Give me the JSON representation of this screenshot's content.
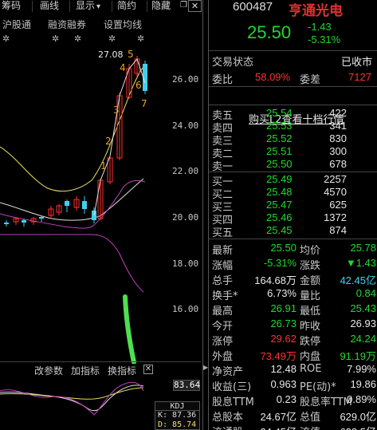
{
  "toolbar": {
    "items": [
      "筹码",
      "画线",
      "显示",
      "简约",
      "隐藏"
    ],
    "display_arrow": "▾",
    "restore_icon": "❐",
    "close_icon": "✕"
  },
  "subbar": {
    "items": [
      "沪股通",
      "融资融券",
      "设置均线"
    ],
    "gear": "✲"
  },
  "chart": {
    "price_ticks": [
      "26.00",
      "24.00",
      "22.00",
      "20.00",
      "18.00",
      "16.00"
    ],
    "high_label": "27.08",
    "wave_labels": [
      "1",
      "2",
      "3",
      "4",
      "5",
      "6",
      "7"
    ]
  },
  "indicator": {
    "tabs": [
      "改参数",
      "加指标",
      "换指标"
    ],
    "close": "✕",
    "last_value": "83.64",
    "kdj_title": "KDJ",
    "k_label": "K: 87.36",
    "d_label": "D: 85.74"
  },
  "quote": {
    "code": "600487",
    "name": "亨通光电",
    "price": "25.50",
    "change": "-1.43",
    "change_pct": "-5.31%",
    "trade_status_label": "交易状态",
    "trade_status": "已收市",
    "weibi_label": "委比",
    "weibi": "58.09%",
    "weicha_label": "委差",
    "weicha": "7127",
    "l2_link": "购买L2查看十档行情",
    "asks": [
      {
        "label": "卖五",
        "price": "25.54",
        "vol": "422"
      },
      {
        "label": "卖四",
        "price": "25.53",
        "vol": "341"
      },
      {
        "label": "卖三",
        "price": "25.52",
        "vol": "830"
      },
      {
        "label": "卖二",
        "price": "25.51",
        "vol": "300"
      },
      {
        "label": "卖一",
        "price": "25.50",
        "vol": "678"
      }
    ],
    "bids": [
      {
        "label": "买一",
        "price": "25.49",
        "vol": "2257"
      },
      {
        "label": "买二",
        "price": "25.48",
        "vol": "4570"
      },
      {
        "label": "买三",
        "price": "25.47",
        "vol": "625"
      },
      {
        "label": "买四",
        "price": "25.46",
        "vol": "1372"
      },
      {
        "label": "买五",
        "price": "25.45",
        "vol": "874"
      }
    ],
    "stats": [
      {
        "l1": "最新",
        "v1": "25.50",
        "c1": "g",
        "l2": "均价",
        "v2": "25.78",
        "c2": "g"
      },
      {
        "l1": "涨幅",
        "v1": "-5.31%",
        "c1": "g",
        "l2": "涨跌",
        "v2": "▼1.43",
        "c2": "g"
      },
      {
        "l1": "总手",
        "v1": "164.68万",
        "c1": "w",
        "l2": "金额",
        "v2": "42.45亿",
        "c2": "c"
      },
      {
        "l1": "换手*",
        "v1": "6.73%",
        "c1": "w",
        "l2": "量比",
        "v2": "0.84",
        "c2": "g"
      },
      {
        "l1": "最高",
        "v1": "26.91",
        "c1": "g",
        "l2": "最低",
        "v2": "25.43",
        "c2": "g"
      },
      {
        "l1": "今开",
        "v1": "26.73",
        "c1": "g",
        "l2": "昨收",
        "v2": "26.93",
        "c2": "w"
      },
      {
        "l1": "涨停",
        "v1": "29.62",
        "c1": "r",
        "l2": "跌停",
        "v2": "24.24",
        "c2": "g"
      },
      {
        "l1": "外盘",
        "v1": "73.49万",
        "c1": "r",
        "l2": "内盘",
        "v2": "91.19万",
        "c2": "g"
      },
      {
        "l1": "净资产",
        "v1": "12.48",
        "c1": "w",
        "l2": "ROE",
        "v2": "7.99%",
        "c2": "w"
      },
      {
        "l1": "收益(三)",
        "v1": "0.963",
        "c1": "w",
        "l2": "PE(动)*",
        "v2": "19.86",
        "c2": "w"
      },
      {
        "l1": "股息TTM",
        "v1": "0.23",
        "c1": "w",
        "l2": "股息率TTM",
        "v2": "0.89%",
        "c2": "w"
      },
      {
        "l1": "总股本",
        "v1": "24.67亿",
        "c1": "w",
        "l2": "总值",
        "v2": "629.0亿",
        "c2": "w"
      },
      {
        "l1": "流通股",
        "v1": "24.45亿",
        "c1": "w",
        "l2": "流值",
        "v2": "623.5亿",
        "c2": "w"
      }
    ]
  },
  "colors": {
    "up": "#ff3030",
    "down": "#21d82b",
    "cyan": "#3fd0f0",
    "arrow": "#4ee04e"
  }
}
